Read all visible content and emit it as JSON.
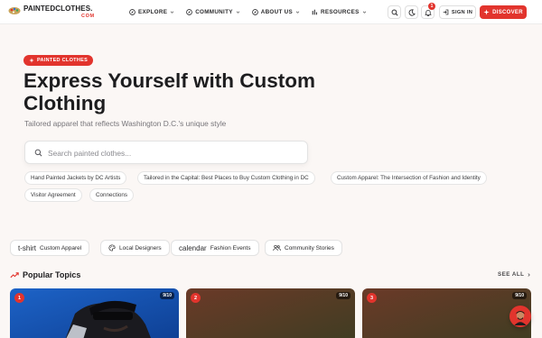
{
  "brand": {
    "name": "PAINTEDCLOTHES.",
    "tld": "COM"
  },
  "nav": [
    {
      "label": "EXPLORE",
      "icon": "compass-icon"
    },
    {
      "label": "COMMUNITY",
      "icon": "compass-icon"
    },
    {
      "label": "ABOUT US",
      "icon": "compass-icon"
    },
    {
      "label": "RESOURCES",
      "icon": "bars-icon"
    }
  ],
  "header": {
    "notification_count": "1",
    "signin_label": "SIGN IN",
    "discover_label": "DISCOVER"
  },
  "hero": {
    "tag": "PAINTED CLOTHES",
    "title": "Express Yourself with Custom Clothing",
    "subtitle": "Tailored apparel that reflects Washington D.C.'s unique style",
    "search_placeholder": "Search painted clothes..."
  },
  "suggestions": [
    "Hand Painted Jackets by DC Artists",
    "Tailored in the Capital: Best Places to Buy Custom Clothing in DC",
    "Custom Apparel: The Intersection of Fashion and Identity",
    "Visitor Agreement",
    "Connections"
  ],
  "categories": [
    {
      "icon_text": "t-shirt",
      "label": "Custom Apparel"
    },
    {
      "icon_text": "",
      "label": "Local Designers"
    },
    {
      "icon_text": "calendar",
      "label": "Fashion Events"
    },
    {
      "icon_text": "",
      "label": "Community Stories"
    }
  ],
  "popular": {
    "title": "Popular Topics",
    "see_all": "SEE ALL",
    "cards": [
      {
        "rank": "1",
        "score": "9/10"
      },
      {
        "rank": "2",
        "score": "9/10"
      },
      {
        "rank": "3",
        "score": "9/10"
      }
    ]
  },
  "colors": {
    "accent": "#e2342d",
    "background": "#fbf7f5",
    "text": "#1d1d1f",
    "muted": "#77757a"
  }
}
